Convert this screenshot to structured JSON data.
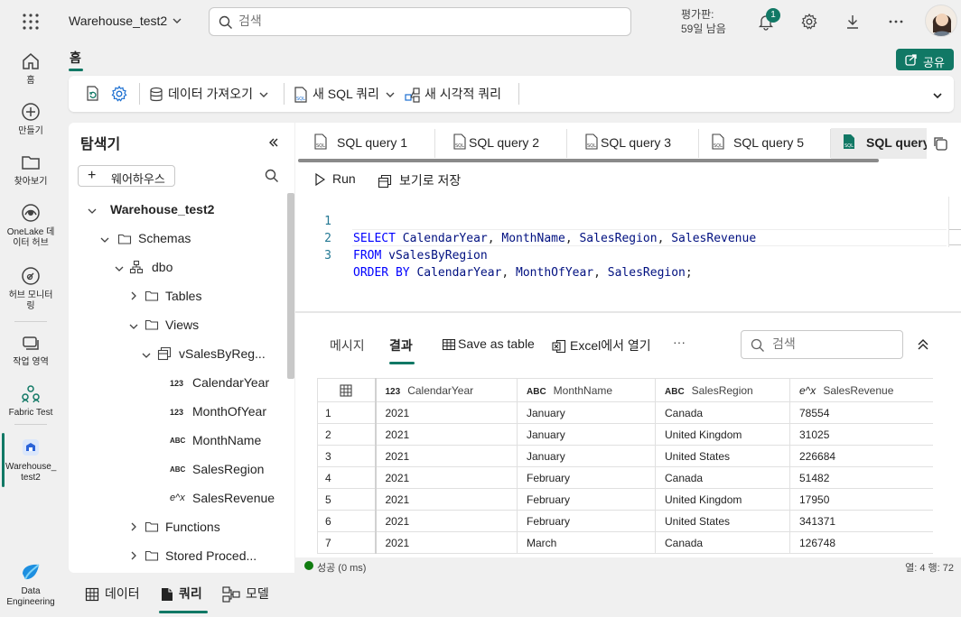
{
  "topbar": {
    "workspace_title": "Warehouse_test2",
    "search_placeholder": "검색",
    "trial_line1": "평가판:",
    "trial_line2": "59일 남음",
    "notification_count": "1"
  },
  "rail": {
    "items": [
      {
        "label": "홈",
        "icon": "home-icon"
      },
      {
        "label": "만들기",
        "icon": "create-icon"
      },
      {
        "label": "찾아보기",
        "icon": "browse-icon"
      },
      {
        "label": "OneLake 데이터 허브",
        "icon": "onelake-icon"
      },
      {
        "label": "허브 모니터링",
        "icon": "monitor-icon"
      },
      {
        "label": "작업 영역",
        "icon": "workspaces-icon"
      },
      {
        "label": "Fabric Test",
        "icon": "fabric-test-icon"
      },
      {
        "label": "Warehouse_ test2",
        "icon": "warehouse-icon"
      },
      {
        "label": "Data Engineering",
        "icon": "data-engineering-icon"
      }
    ]
  },
  "ribbon": {
    "home_tab": "홈",
    "share_label": "공유",
    "get_data": "데이터 가져오기",
    "new_sql_query": "새 SQL 쿼리",
    "new_visual_query": "새 시각적 쿼리"
  },
  "explorer": {
    "title": "탐색기",
    "warehouse_button": "웨어하우스",
    "tree": {
      "warehouse": "Warehouse_test2",
      "schemas": "Schemas",
      "dbo": "dbo",
      "tables": "Tables",
      "views": "Views",
      "view_name": "vSalesByReg...",
      "columns": [
        "CalendarYear",
        "MonthOfYear",
        "MonthName",
        "SalesRegion",
        "SalesRevenue"
      ],
      "column_types": [
        "123",
        "123",
        "ABC",
        "ABC",
        "e^x"
      ],
      "functions": "Functions",
      "stored_procedures": "Stored Proced..."
    }
  },
  "editor": {
    "tabs": [
      "SQL query 1",
      "SQL query 2",
      "SQL query 3",
      "SQL query 5",
      "SQL query"
    ],
    "run_label": "Run",
    "save_as_view": "보기로 저장",
    "line_numbers": [
      "1",
      "2",
      "3"
    ],
    "code": {
      "l1_kw": "SELECT",
      "l1_rest1": "CalendarYear",
      "l1_rest2": "MonthName",
      "l1_rest3": "SalesRegion",
      "l1_rest4": "SalesRevenue",
      "l2_kw": "FROM",
      "l2_id": "vSalesByRegion",
      "l3_kw": "ORDER BY",
      "l3_id1": "CalendarYear",
      "l3_id2": "MonthOfYear",
      "l3_id3": "SalesRegion"
    }
  },
  "results": {
    "tabs": {
      "messages": "메시지",
      "results": "결과",
      "save_as_table": "Save as table",
      "open_in_excel": "Excel에서 열기",
      "more": "···"
    },
    "search_placeholder": "검색",
    "columns": [
      {
        "type": "123",
        "name": "CalendarYear"
      },
      {
        "type": "ABC",
        "name": "MonthName"
      },
      {
        "type": "ABC",
        "name": "SalesRegion"
      },
      {
        "type": "e^x",
        "name": "SalesRevenue"
      }
    ],
    "rows": [
      [
        "1",
        "2021",
        "January",
        "Canada",
        "78554"
      ],
      [
        "2",
        "2021",
        "January",
        "United Kingdom",
        "31025"
      ],
      [
        "3",
        "2021",
        "January",
        "United States",
        "226684"
      ],
      [
        "4",
        "2021",
        "February",
        "Canada",
        "51482"
      ],
      [
        "5",
        "2021",
        "February",
        "United Kingdom",
        "17950"
      ],
      [
        "6",
        "2021",
        "February",
        "United States",
        "341371"
      ],
      [
        "7",
        "2021",
        "March",
        "Canada",
        "126748"
      ]
    ],
    "status_ok": "성공 (0 ms)",
    "status_pos": "열: 4  행: 72"
  },
  "bottom_tabs": {
    "data": "데이터",
    "query": "쿼리",
    "model": "모델"
  },
  "colors": {
    "accent": "#117865",
    "keyword": "#0000ff",
    "identifier": "#001080"
  }
}
